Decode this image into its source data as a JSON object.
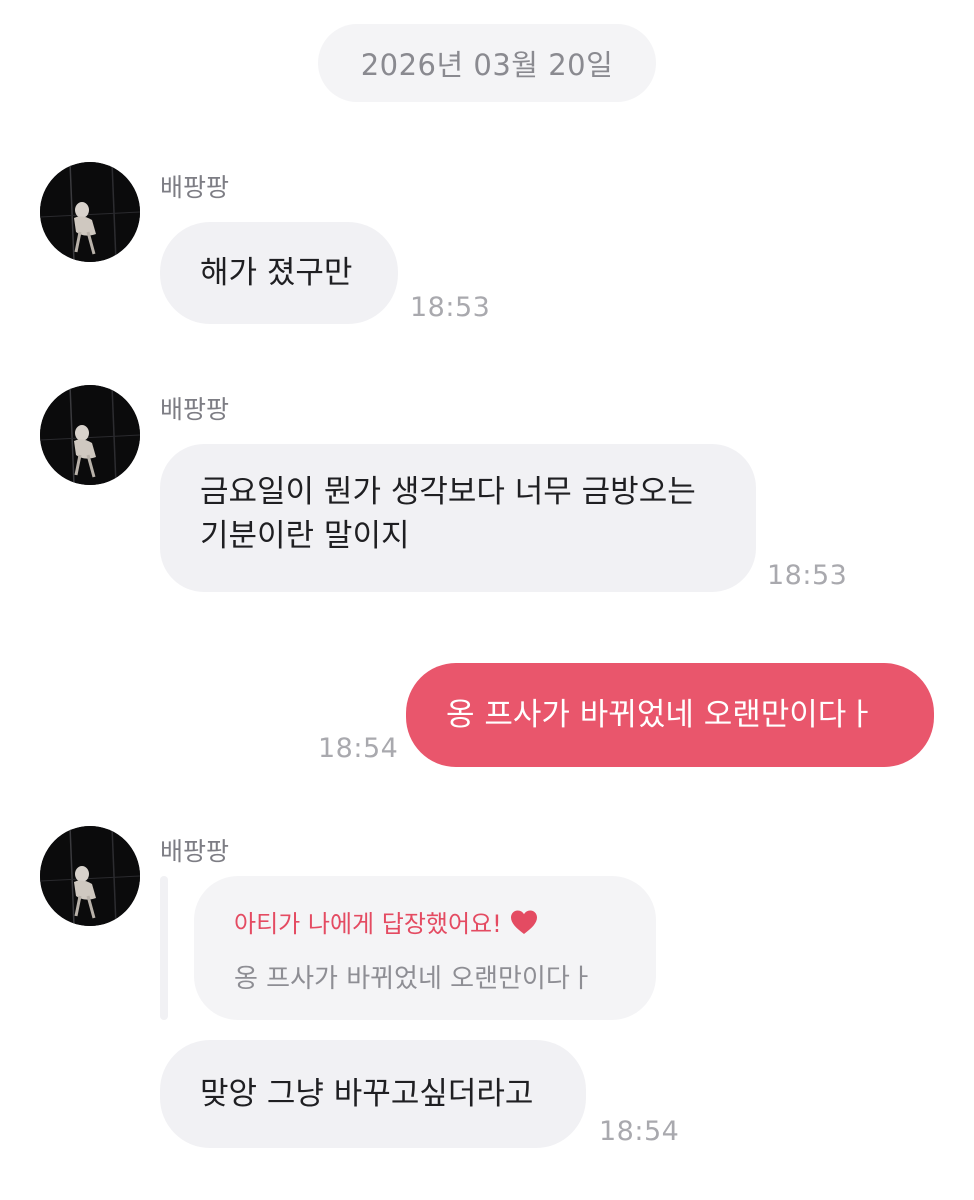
{
  "date_divider": "2026년 03월 20일",
  "messages": [
    {
      "sender": "배팡팡",
      "text": "해가 졌구만",
      "time": "18:53"
    },
    {
      "sender": "배팡팡",
      "text": "금요일이 뭔가 생각보다 너무 금방오는\n기분이란 말이지",
      "time": "18:53"
    },
    {
      "text": "옹 프사가 바뀌었네 오랜만이다ㅏ",
      "time": "18:54"
    },
    {
      "sender": "배팡팡",
      "reply_header": "아티가 나에게 답장했어요!",
      "reply_icon": "heart-icon",
      "reply_quote": "옹 프사가 바뀌었네 오랜만이다ㅏ",
      "text": "맞앙 그냥 바꾸고싶더라고",
      "time": "18:54"
    }
  ],
  "colors": {
    "outgoing_bubble": "#e9566c",
    "incoming_bubble": "#f1f1f4",
    "reply_accent": "#e44b62"
  }
}
